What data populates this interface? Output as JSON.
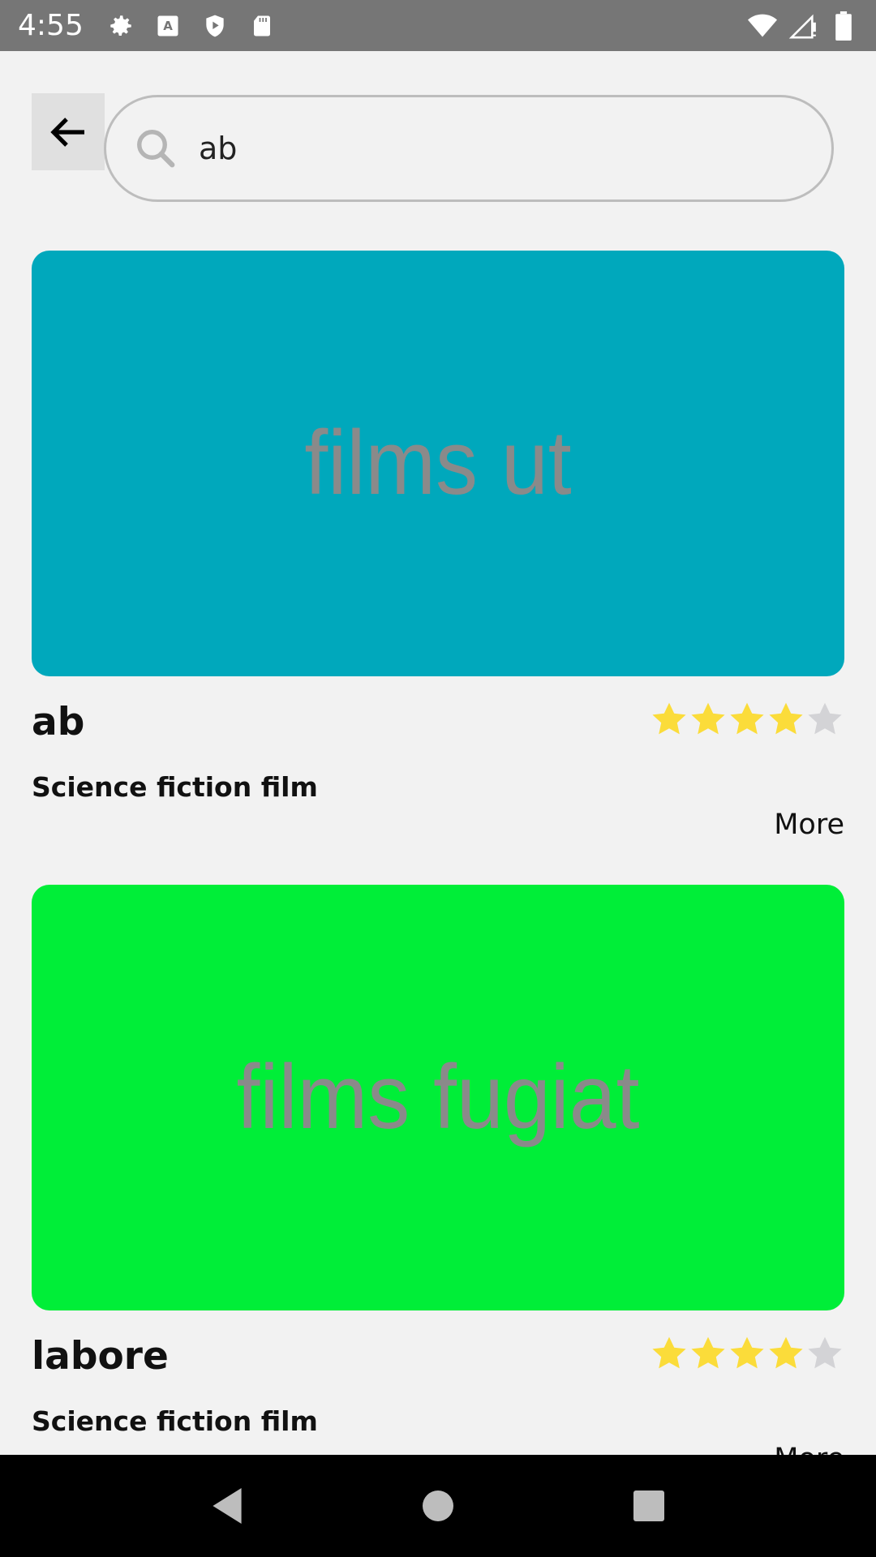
{
  "status_bar": {
    "time": "4:55",
    "left_icons": [
      "gear-icon",
      "font-a-icon",
      "shield-play-icon",
      "sd-card-icon"
    ],
    "right_icons": [
      "wifi-icon",
      "signal-icon",
      "battery-icon"
    ]
  },
  "search": {
    "value": "ab",
    "placeholder": ""
  },
  "results": [
    {
      "image_text": "films ut",
      "image_color": "#00a8bc",
      "title": "ab",
      "subtitle": "Science fiction film",
      "rating": 4,
      "rating_max": 5,
      "more_label": "More"
    },
    {
      "image_text": "films fugiat",
      "image_color": "#00ee38",
      "title": "labore",
      "subtitle": "Science fiction film",
      "rating": 4,
      "rating_max": 5,
      "more_label": "More"
    }
  ],
  "colors": {
    "star_filled": "#fbdc3a",
    "star_empty": "#d3d3d6",
    "background": "#f2f2f2"
  },
  "nav_bar": {
    "icons": [
      "back-triangle-icon",
      "home-circle-icon",
      "recents-square-icon"
    ]
  }
}
